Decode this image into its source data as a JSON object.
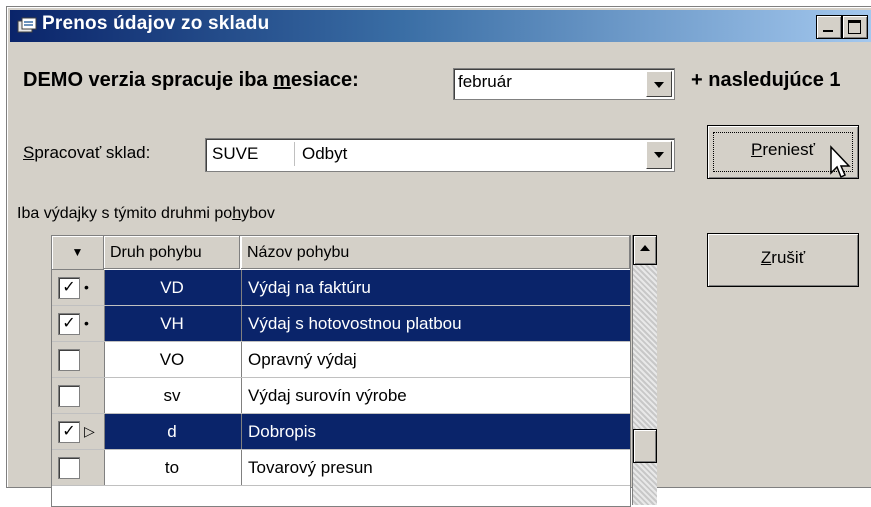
{
  "window": {
    "title": "Prenos údajov zo skladu"
  },
  "demo": {
    "label_before": "DEMO verzia spracuje iba ",
    "label_u": "m",
    "label_after": "esiace:",
    "month": "február",
    "suffix": "+ nasledujúce 1"
  },
  "warehouse": {
    "label_u": "S",
    "label_rest": "pracovať sklad:",
    "code": "SUVE",
    "name": "Odbyt"
  },
  "buttons": {
    "transfer_u": "P",
    "transfer_rest": "reniesť",
    "cancel_u": "Z",
    "cancel_rest": "rušiť"
  },
  "list": {
    "caption_before": "Iba výdajky s týmito druhmi po",
    "caption_u": "h",
    "caption_after": "ybov",
    "headers": {
      "marker": "▼",
      "code": "Druh pohybu",
      "name": "Názov pohybu"
    },
    "rows": [
      {
        "checked": "✓",
        "marker": "•",
        "code": "VD",
        "name": "Výdaj na faktúru"
      },
      {
        "checked": "✓",
        "marker": "•",
        "code": "VH",
        "name": "Výdaj s hotovostnou platbou"
      },
      {
        "checked": "",
        "marker": "",
        "code": "VO",
        "name": "Opravný výdaj"
      },
      {
        "checked": "",
        "marker": "",
        "code": "sv",
        "name": "Výdaj surovín výrobe"
      },
      {
        "checked": "✓",
        "marker": "▷",
        "code": "d",
        "name": "Dobropis"
      },
      {
        "checked": "",
        "marker": "",
        "code": "to",
        "name": "Tovarový presun"
      }
    ]
  }
}
